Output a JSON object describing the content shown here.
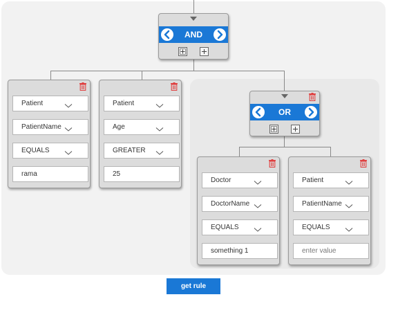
{
  "root_group": {
    "operator": "AND"
  },
  "sub_group": {
    "operator": "OR"
  },
  "conditions": [
    {
      "entity": "Patient",
      "field": "PatientName",
      "operator": "EQUALS",
      "value": "rama",
      "placeholder": ""
    },
    {
      "entity": "Patient",
      "field": "Age",
      "operator": "GREATER",
      "value": "25",
      "placeholder": ""
    },
    {
      "entity": "Doctor",
      "field": "DoctorName",
      "operator": "EQUALS",
      "value": "something 1",
      "placeholder": ""
    },
    {
      "entity": "Patient",
      "field": "PatientName",
      "operator": "EQUALS",
      "value": "",
      "placeholder": "enter value"
    }
  ],
  "actions": {
    "get_rule_label": "get rule"
  },
  "colors": {
    "accent": "#1a78d6",
    "delete": "#e04040",
    "panel": "#f2f2f2"
  },
  "icons": [
    "collapse-caret-icon",
    "chevron-left-icon",
    "chevron-right-icon",
    "add-group-icon",
    "add-condition-icon",
    "trash-icon",
    "dropdown-chevron-icon"
  ]
}
